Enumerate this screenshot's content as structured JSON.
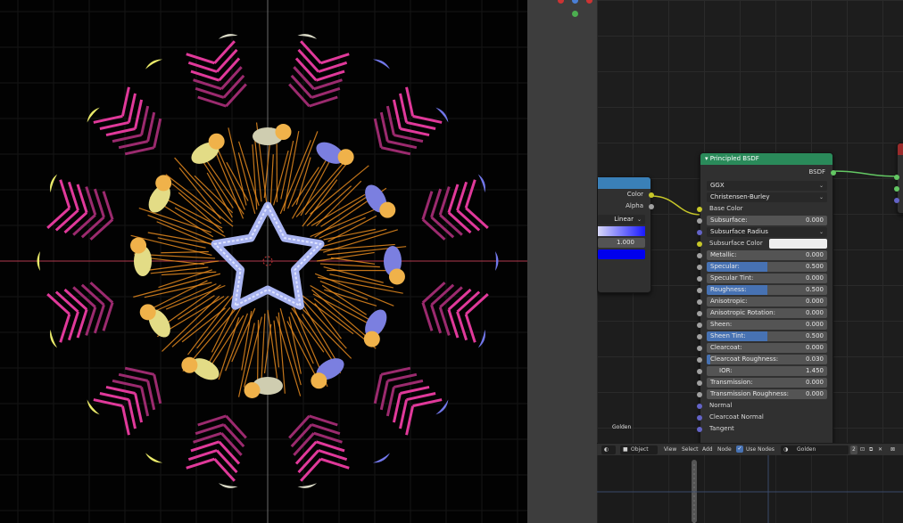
{
  "viewport": {
    "background": "#020202",
    "axis_x_color": "#b33a4d",
    "axis_y_color": "#6a8a3a"
  },
  "partial_node": {
    "header_color": "#3a80b8",
    "outputs": [
      "Color",
      "Alpha"
    ],
    "interpolation": "Linear",
    "value": "1.000"
  },
  "principled_node": {
    "title": "Principled BSDF",
    "header_color": "#2a8a5a",
    "output": "BSDF",
    "distribution": "GGX",
    "subsurface_method": "Christensen-Burley",
    "base_color_label": "Base Color",
    "subsurface": {
      "label": "Subsurface:",
      "value": "0.000"
    },
    "subsurface_radius": "Subsurface Radius",
    "subsurface_color": "Subsurface Color",
    "metallic": {
      "label": "Metallic:",
      "value": "0.000",
      "fraction": 0
    },
    "specular": {
      "label": "Specular:",
      "value": "0.500",
      "fraction": 0.5
    },
    "specular_tint": {
      "label": "Specular Tint:",
      "value": "0.000",
      "fraction": 0
    },
    "roughness": {
      "label": "Roughness:",
      "value": "0.500",
      "fraction": 0.5
    },
    "anisotropic": {
      "label": "Anisotropic:",
      "value": "0.000",
      "fraction": 0
    },
    "anisotropic_rotation": {
      "label": "Anisotropic Rotation:",
      "value": "0.000",
      "fraction": 0
    },
    "sheen": {
      "label": "Sheen:",
      "value": "0.000",
      "fraction": 0
    },
    "sheen_tint": {
      "label": "Sheen Tint:",
      "value": "0.500",
      "fraction": 0.5
    },
    "clearcoat": {
      "label": "Clearcoat:",
      "value": "0.000",
      "fraction": 0
    },
    "clearcoat_roughness": {
      "label": "Clearcoat Roughness:",
      "value": "0.030",
      "fraction": 0.03
    },
    "ior": {
      "label": "IOR:",
      "value": "1.450"
    },
    "transmission": {
      "label": "Transmission:",
      "value": "0.000",
      "fraction": 0
    },
    "transmission_roughness": {
      "label": "Transmission Roughness:",
      "value": "0.000",
      "fraction": 0
    },
    "normal": "Normal",
    "clearcoat_normal": "Clearcoat Normal",
    "tangent": "Tangent"
  },
  "material_label": "Golden",
  "header_bar": {
    "mode": "Object",
    "menu": [
      "View",
      "Select",
      "Add",
      "Node"
    ],
    "use_nodes_label": "Use Nodes",
    "material_name": "Golden",
    "user_count": "2"
  }
}
